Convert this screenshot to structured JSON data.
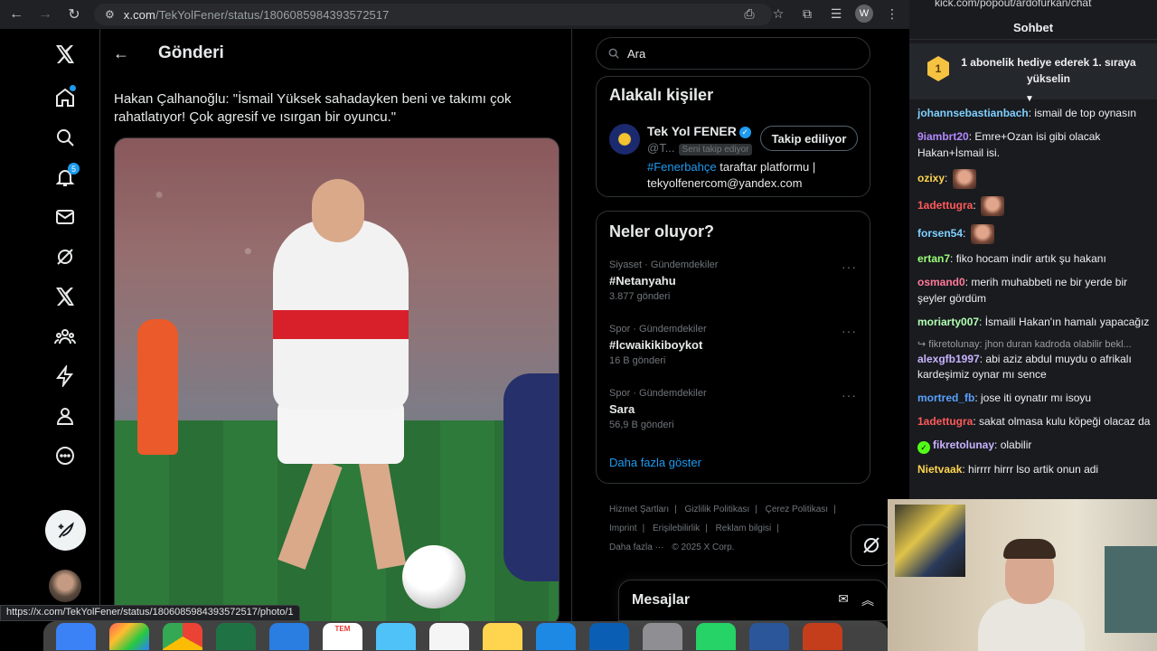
{
  "browser": {
    "url_host": "x.com",
    "url_path": "/TekYolFener/status/1806085984393572517",
    "status_url": "https://x.com/TekYolFener/status/1806085984393572517/photo/1"
  },
  "nav": {
    "notifications_badge": "5"
  },
  "main": {
    "title": "Gönderi",
    "tweet_text": "Hakan Çalhanoğlu: \"İsmail Yüksek sahadayken beni ve takımı çok rahatlatıyor! Çok agresif ve ısırgan bir oyuncu.\""
  },
  "search": {
    "placeholder": "Ara"
  },
  "related": {
    "title": "Alakalı kişiler",
    "name": "Tek Yol FENER",
    "handle": "@T...",
    "follows_you": "Seni takip ediyor",
    "follow_label": "Takip ediliyor",
    "bio_tag": "#Fenerbahçe",
    "bio_rest": " taraftar platformu | tekyolfenercom@yandex.com"
  },
  "trends": {
    "title": "Neler oluyor?",
    "items": [
      {
        "meta": "Siyaset · Gündemdekiler",
        "name": "#Netanyahu",
        "count": "3.877 gönderi"
      },
      {
        "meta": "Spor · Gündemdekiler",
        "name": "#lcwaikikiboykot",
        "count": "16 B gönderi"
      },
      {
        "meta": "Spor · Gündemdekiler",
        "name": "Sara",
        "count": "56,9 B gönderi"
      }
    ],
    "show_more": "Daha fazla göster"
  },
  "footer": {
    "links": [
      "Hizmet Şartları",
      "|",
      "Gizlilik Politikası",
      "|",
      "Çerez Politikası",
      "|",
      "Imprint",
      "|",
      "Erişilebilirlik",
      "|",
      "Reklam bilgisi",
      "|",
      "Daha fazla ···",
      "© 2025 X Corp."
    ]
  },
  "messages": {
    "title": "Mesajlar"
  },
  "dock": {
    "calendar_month": "TEM"
  },
  "chat": {
    "url": "kick.com/popout/ardofurkan/chat",
    "title": "Sohbet",
    "pinned_rank": "1",
    "pinned_text": "1 abonelik hediye ederek 1. sıraya yükselin",
    "reply_text": "↪ fikretolunay: jhon duran kadroda olabilir bekl...",
    "messages": [
      {
        "user": "johannsebastianbach",
        "color": "#7fd0ff",
        "text": "ismail de top oynasın"
      },
      {
        "user": "9iambrt20",
        "color": "#b388ff",
        "text": "Emre+Ozan isi gibi olacak Hakan+İsmail isi."
      },
      {
        "user": "ozixy",
        "color": "#ffd54f",
        "text": "",
        "emote": true
      },
      {
        "user": "1adettugra",
        "color": "#ff5a5a",
        "text": "",
        "emote": true
      },
      {
        "user": "forsen54",
        "color": "#7fd0ff",
        "text": "",
        "emote": true
      },
      {
        "user": "ertan7",
        "color": "#9cff7a",
        "text": "fiko hocam indir artık şu hakanı"
      },
      {
        "user": "osmand0",
        "color": "#ff7a9a",
        "text": "merih muhabbeti ne bir yerde bir şeyler gördüm"
      },
      {
        "user": "moriarty007",
        "color": "#b2ffb2",
        "text": "İsmaili Hakan'ın hamalı yapacağız"
      },
      {
        "user": "alexgfb1997",
        "color": "#c9b3ff",
        "text": "abi aziz abdul muydu o afrikalı kardeşimiz oynar mı sence",
        "reply": true
      },
      {
        "user": "mortred_fb",
        "color": "#5aa0ff",
        "text": "jose iti oynatır mı isoyu"
      },
      {
        "user": "1adettugra",
        "color": "#ff5a5a",
        "text": "sakat olmasa kulu köpeği olacaz da"
      },
      {
        "user": "fikretolunay",
        "color": "#c9b3ff",
        "text": "olabilir",
        "badge": true
      },
      {
        "user": "Nietvaak",
        "color": "#ffd54f",
        "text": "hirrrr hirrr lso artik onun adi"
      }
    ]
  },
  "colors": {
    "accent": "#1d9bf0",
    "kick_green": "#53fc18"
  }
}
